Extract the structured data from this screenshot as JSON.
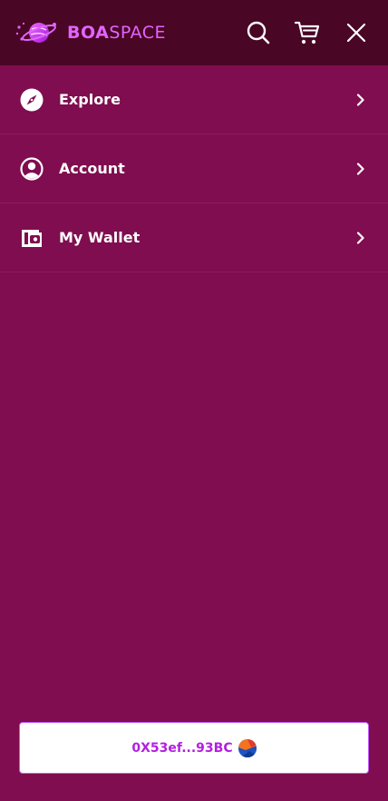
{
  "brand": {
    "name_bold": "BOA",
    "name_light": "SPACE",
    "accent_color": "#e264ff"
  },
  "header": {
    "icons": [
      "search-icon",
      "cart-icon",
      "close-icon"
    ]
  },
  "menu": {
    "items": [
      {
        "label": "Explore",
        "icon": "compass-icon"
      },
      {
        "label": "Account",
        "icon": "user-circle-icon"
      },
      {
        "label": "My Wallet",
        "icon": "wallet-icon"
      }
    ]
  },
  "wallet": {
    "address": "0X53ef...93BC",
    "avatar_icon": "wallet-avatar-icon"
  },
  "colors": {
    "background": "#7f0d4f",
    "header_background": "#4a0625",
    "address_text": "#b31fe0"
  }
}
